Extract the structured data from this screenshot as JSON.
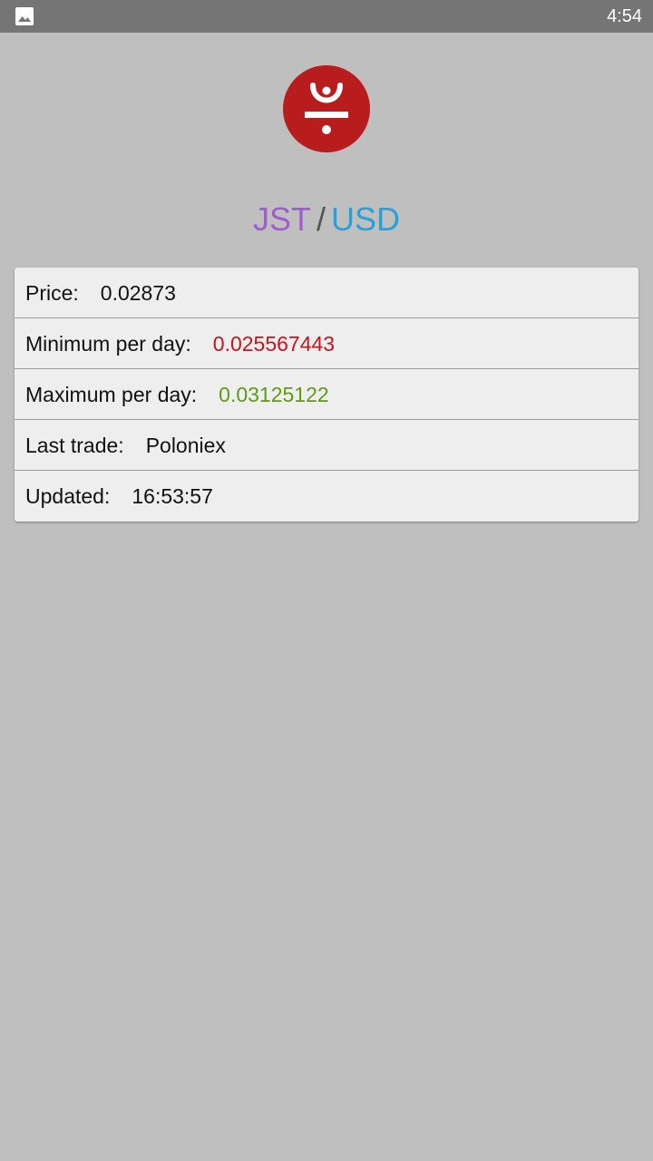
{
  "status_bar": {
    "time": "4:54",
    "notification_icon": "image-icon"
  },
  "logo": {
    "icon": "jst-logo-icon",
    "color": "#b81c1c"
  },
  "pair": {
    "base": "JST",
    "separator": "/",
    "quote": "USD",
    "base_color": "#a25ccf",
    "quote_color": "#2aa0d6"
  },
  "stats": {
    "price_label": "Price:",
    "price_value": "0.02873",
    "min_label": "Minimum per day:",
    "min_value": "0.025567443",
    "min_color": "#c8141c",
    "max_label": "Maximum per day:",
    "max_value": "0.03125122",
    "max_color": "#5e9b12",
    "last_trade_label": "Last trade:",
    "last_trade_value": "Poloniex",
    "updated_label": "Updated:",
    "updated_value": "16:53:57"
  }
}
